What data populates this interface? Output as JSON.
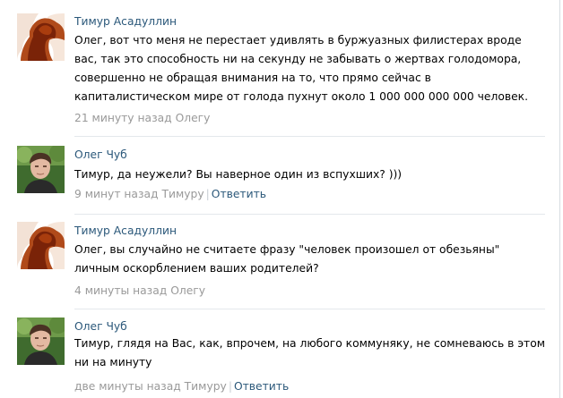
{
  "comments": [
    {
      "author": "Тимур Асадуллин",
      "text": "Олег, вот что меня не перестает удивлять в буржуазных филистерах вроде вас, так это способность ни на секунду не забывать о жертвах голодомора, совершенно не обращая внимания на то, что прямо сейчас в капиталистическом мире от голода пухнут около 1 000 000 000 000 человек.",
      "time": "21 минуту назад",
      "reply_to": "Олегу"
    },
    {
      "author": "Олег Чуб",
      "text": "Тимур, да неужели? Вы наверное один из вспухших? )))",
      "time": "9 минут назад",
      "reply_to": "Тимуру",
      "action": "Ответить"
    },
    {
      "author": "Тимур Асадуллин",
      "text": "Олег, вы случайно не считаете фразу \"человек произошел от обезьяны\" личным оскорблением ваших родителей?",
      "time": "4 минуты назад",
      "reply_to": "Олегу"
    },
    {
      "author": "Олег Чуб",
      "text": "Тимур, глядя на Вас, как, впрочем, на любого коммуняку, не сомневаюсь в этом ни на минуту",
      "time": "две минуты назад",
      "reply_to": "Тимуру",
      "action": "Ответить"
    }
  ]
}
